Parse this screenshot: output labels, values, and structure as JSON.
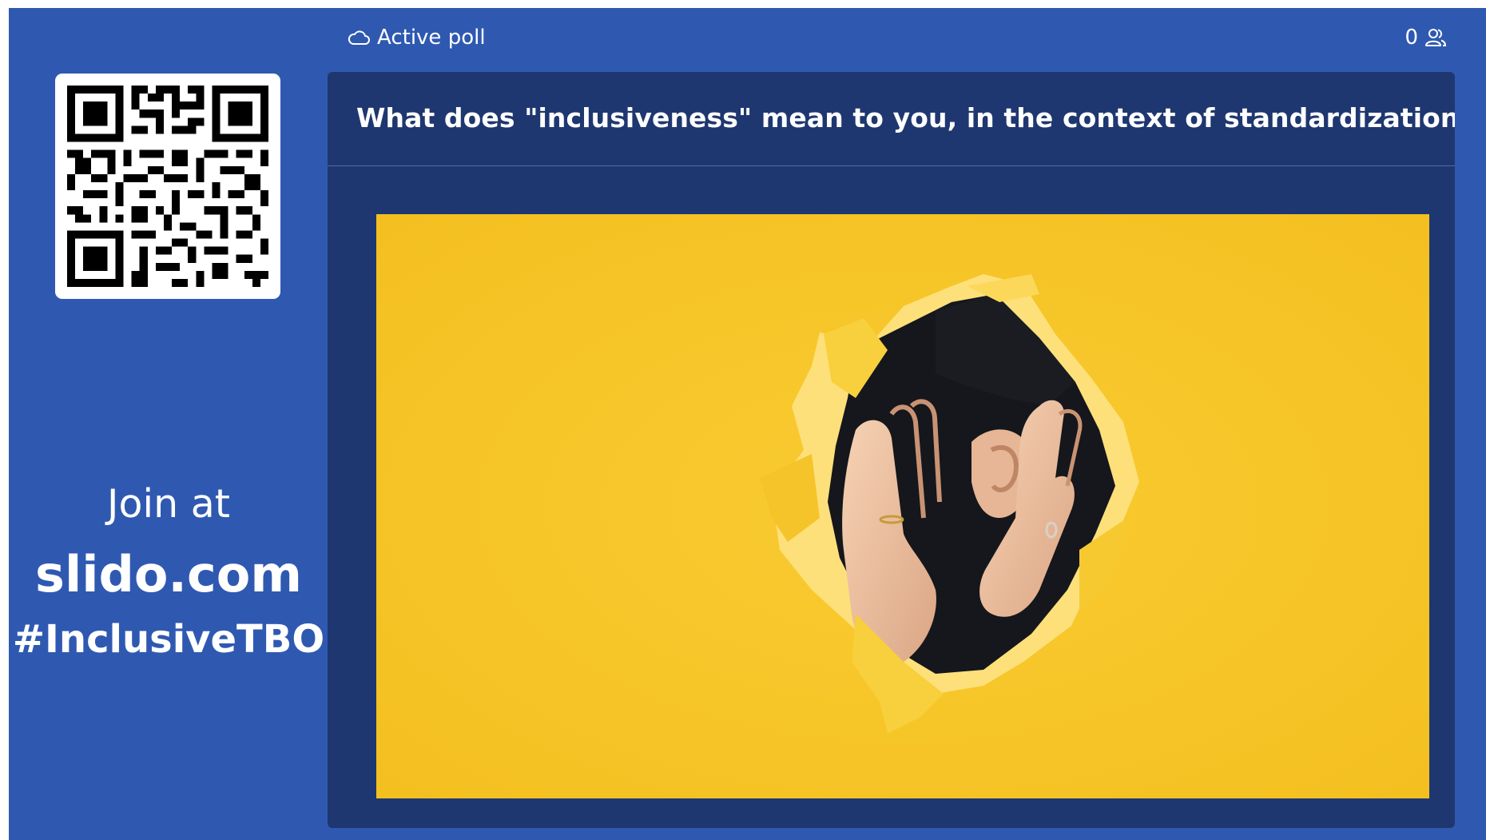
{
  "sidebar": {
    "join_line1": "Join at",
    "join_line2": "slido.com",
    "join_line3": "#InclusiveTBO",
    "qr_code": "qr-code-icon"
  },
  "topbar": {
    "status_icon": "cloud-icon",
    "status_label": "Active poll",
    "participant_count": "0",
    "participant_icon": "users-icon"
  },
  "poll": {
    "question": "What does \"inclusiveness\" mean to you, in the context of standardization?",
    "image": "torn-paper-ear-listening-photo"
  },
  "colors": {
    "background": "#2f59b1",
    "panel": "#1f3770",
    "photo_yellow": "#f7c52b",
    "text": "#ffffff"
  }
}
